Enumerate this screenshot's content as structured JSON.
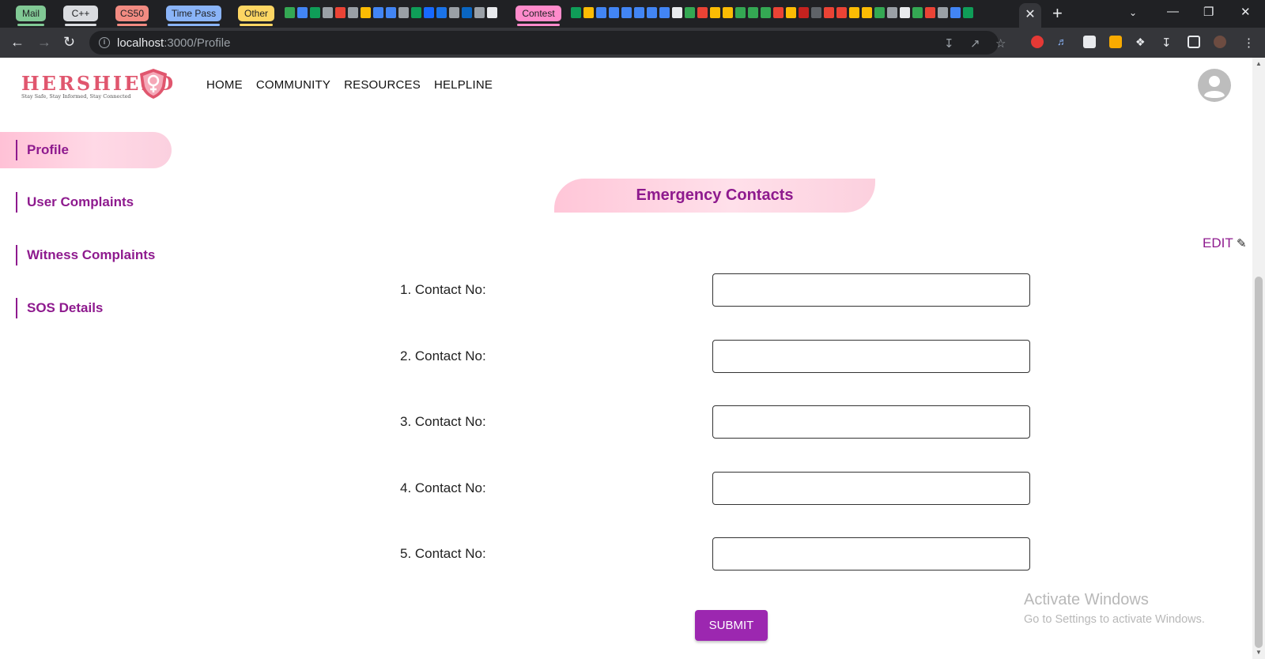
{
  "browser": {
    "tab_groups": [
      {
        "label": "Mail",
        "color": "#81c995"
      },
      {
        "label": "C++",
        "color": "#dadce0"
      },
      {
        "label": "CS50",
        "color": "#f28b82"
      },
      {
        "label": "Time Pass",
        "color": "#8ab4f8"
      },
      {
        "label": "Other",
        "color": "#fdd663"
      },
      {
        "label": "Contest",
        "color": "#ff8bcb"
      }
    ],
    "url_host": "localhost",
    "url_path": ":3000/Profile",
    "active_tab_close": "✕",
    "new_tab": "+"
  },
  "header": {
    "logo_text": "HERSHIELD",
    "logo_tagline": "Stay Safe, Stay Informed, Stay Connected",
    "nav": [
      "HOME",
      "COMMUNITY",
      "RESOURCES",
      "HELPLINE"
    ]
  },
  "sidebar": {
    "items": [
      {
        "label": "Profile",
        "active": true
      },
      {
        "label": "User Complaints",
        "active": false
      },
      {
        "label": "Witness Complaints",
        "active": false
      },
      {
        "label": "SOS Details",
        "active": false
      }
    ]
  },
  "main": {
    "title": "Emergency Contacts",
    "edit_label": "EDIT",
    "contacts": [
      {
        "label": "1. Contact No:",
        "value": ""
      },
      {
        "label": "2. Contact No:",
        "value": ""
      },
      {
        "label": "3. Contact No:",
        "value": ""
      },
      {
        "label": "4. Contact No:",
        "value": ""
      },
      {
        "label": "5. Contact No:",
        "value": ""
      }
    ],
    "submit_label": "SUBMIT"
  },
  "watermark": {
    "line1": "Activate Windows",
    "line2": "Go to Settings to activate Windows."
  },
  "colors": {
    "accent": "#8e1a8e",
    "button": "#9c27b0",
    "logo": "#e0566e"
  }
}
